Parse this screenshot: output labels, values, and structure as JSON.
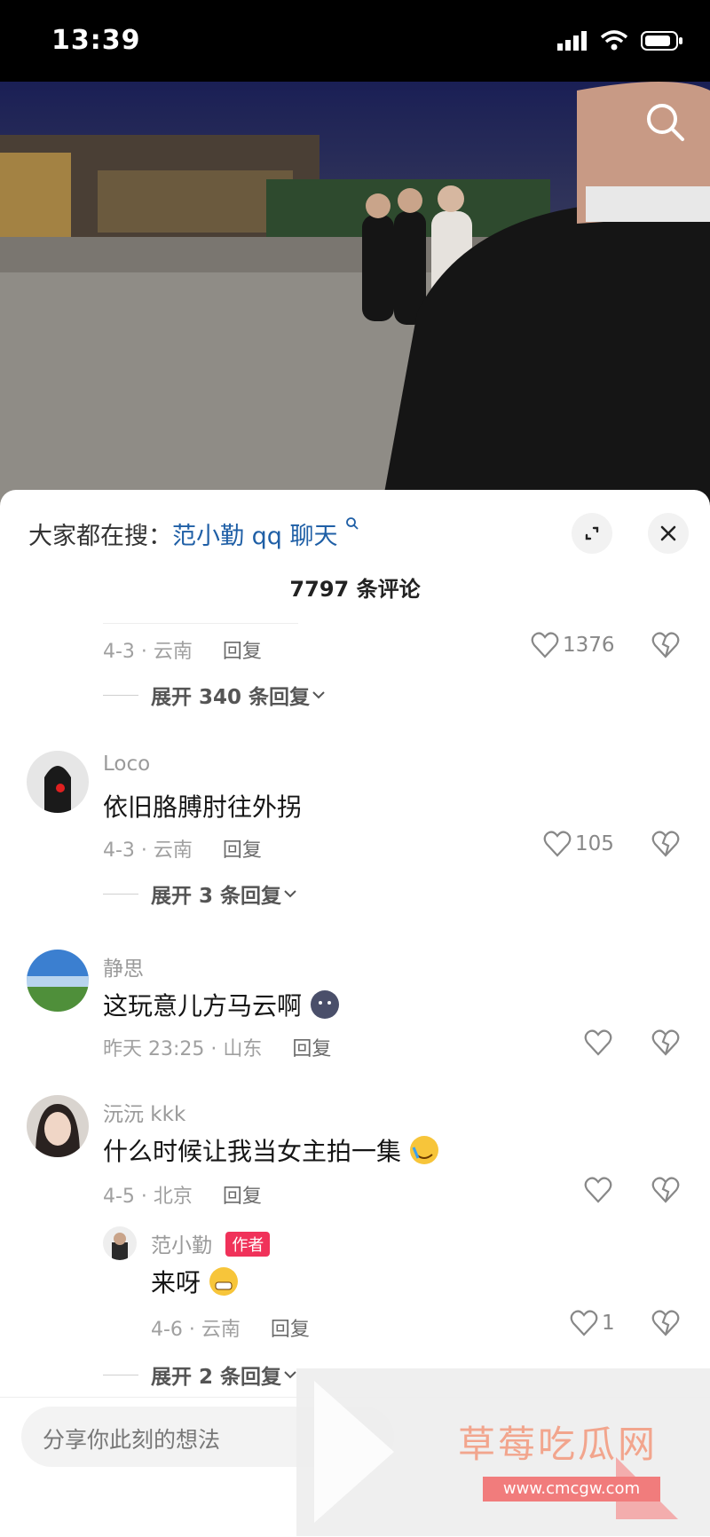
{
  "status": {
    "time": "13:39"
  },
  "sheet": {
    "search_prefix": "大家都在搜：",
    "search_keyword": "范小勤 qq 聊天",
    "comment_count": "7797 条评论"
  },
  "comments": [
    {
      "meta": "4-3 · 云南",
      "reply": "回复",
      "likes": "1376",
      "expand": "展开 340 条回复"
    },
    {
      "name": "Loco",
      "text": "依旧胳膊肘往外拐",
      "meta": "4-3 · 云南",
      "reply": "回复",
      "likes": "105",
      "expand": "展开 3 条回复"
    },
    {
      "name": "静思",
      "text": "这玩意儿方马云啊",
      "meta": "昨天 23:25 · 山东",
      "reply": "回复",
      "likes": ""
    },
    {
      "name": "沅沅 kkk",
      "text": "什么时候让我当女主拍一集",
      "meta": "4-5 · 北京",
      "reply": "回复",
      "likes": ""
    }
  ],
  "sub_reply": {
    "name": "范小勤",
    "badge": "作者",
    "text": "来呀",
    "meta": "4-6 · 云南",
    "reply": "回复",
    "likes": "1",
    "expand": "展开 2 条回复"
  },
  "input": {
    "placeholder": "分享你此刻的想法"
  },
  "watermark": {
    "title": "草莓吃瓜网",
    "url": "www.cmcgw.com"
  },
  "colors": {
    "keyword": "#1f5fa6",
    "author_badge": "#f0325a"
  },
  "icons": [
    "search-icon",
    "expand-icon",
    "close-icon",
    "heart-icon",
    "dislike-icon",
    "chevron-down-icon",
    "signal-icon",
    "wifi-icon",
    "battery-icon"
  ]
}
